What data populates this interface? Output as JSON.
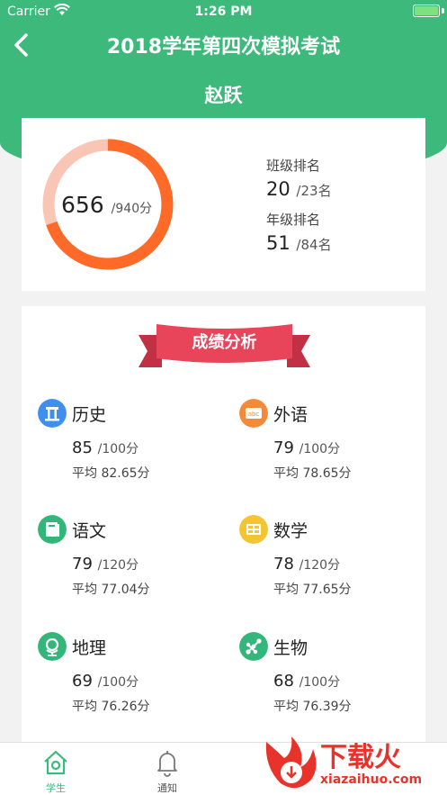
{
  "status_bar": {
    "carrier": "Carrier",
    "time": "1:26 PM"
  },
  "header": {
    "title": "2018学年第四次模拟考试",
    "student_name": "赵跃"
  },
  "score_summary": {
    "total": "656",
    "total_max": "/940分",
    "total_fraction": 0.698,
    "class_rank_label": "班级排名",
    "class_rank": "20",
    "class_rank_total": "/23名",
    "grade_rank_label": "年级排名",
    "grade_rank": "51",
    "grade_rank_total": "/84名"
  },
  "analysis": {
    "title": "成绩分析",
    "subjects": [
      {
        "name": "历史",
        "score": "85",
        "max": "/100分",
        "avg": "平均 82.65分",
        "icon": "history-icon",
        "color": "#3f8ff0"
      },
      {
        "name": "外语",
        "score": "79",
        "max": "/100分",
        "avg": "平均 78.65分",
        "icon": "abc-icon",
        "color": "#f28a3a"
      },
      {
        "name": "语文",
        "score": "79",
        "max": "/120分",
        "avg": "平均 77.04分",
        "icon": "book-icon",
        "color": "#32b67a"
      },
      {
        "name": "数学",
        "score": "78",
        "max": "/120分",
        "avg": "平均 77.65分",
        "icon": "abacus-icon",
        "color": "#f4c531"
      },
      {
        "name": "地理",
        "score": "69",
        "max": "/100分",
        "avg": "平均 76.26分",
        "icon": "globe-icon",
        "color": "#32b67a"
      },
      {
        "name": "生物",
        "score": "68",
        "max": "/100分",
        "avg": "平均 76.39分",
        "icon": "molecule-icon",
        "color": "#32b67a"
      }
    ]
  },
  "tabs": [
    {
      "label": "学生",
      "icon": "home-icon",
      "active": true
    },
    {
      "label": "通知",
      "icon": "bell-icon",
      "active": false
    }
  ],
  "watermark": {
    "text": "下载火",
    "url": "xiazaihuo.com"
  },
  "colors": {
    "brand": "#3cb97b",
    "ring": "#ff6a28",
    "ring_track": "#f9c6b6",
    "ribbon": "#e8445a"
  }
}
